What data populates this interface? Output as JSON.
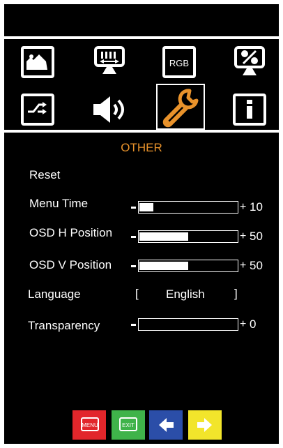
{
  "colors": {
    "background": "#000000",
    "foreground": "#ffffff",
    "accent": "#e8922b",
    "menu_button": "#e2262b",
    "exit_button": "#3fb34a",
    "left_button": "#2b4ea8",
    "right_button": "#f2e52b"
  },
  "top_icons": [
    {
      "name": "picture-icon",
      "selected": false
    },
    {
      "name": "display-settings-icon",
      "selected": false
    },
    {
      "name": "rgb-icon",
      "text": "RGB",
      "selected": false
    },
    {
      "name": "percent-display-icon",
      "selected": false
    },
    {
      "name": "input-source-icon",
      "selected": false
    },
    {
      "name": "speaker-icon",
      "selected": false
    },
    {
      "name": "wrench-icon",
      "selected": true
    },
    {
      "name": "info-icon",
      "selected": false
    }
  ],
  "section_title": "OTHER",
  "items": {
    "reset": {
      "label": "Reset"
    },
    "menu_time": {
      "label": "Menu Time",
      "value": "10",
      "level": 0.14
    },
    "osd_h": {
      "label": "OSD H Position",
      "value": "50",
      "level": 0.5
    },
    "osd_v": {
      "label": "OSD V Position",
      "value": "50",
      "level": 0.5
    },
    "language": {
      "label": "Language",
      "value": "English",
      "open_bracket": "[",
      "close_bracket": "]"
    },
    "transparency": {
      "label": "Transparency",
      "value": "0",
      "level": 0
    }
  },
  "nav": {
    "menu_label": "MENU",
    "exit_label": "EXIT",
    "left_icon": "arrow-left-icon",
    "right_icon": "arrow-right-icon"
  }
}
